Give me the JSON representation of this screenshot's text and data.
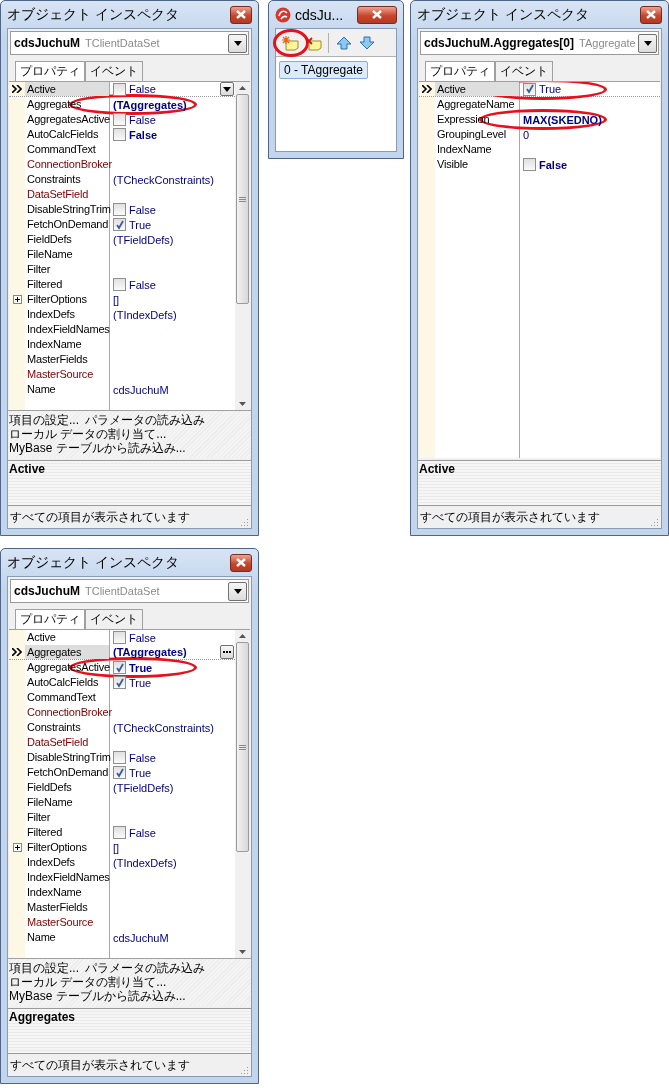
{
  "windows": [
    {
      "kind": "inspector",
      "title": "オブジェクト インスペクタ",
      "object_name": "cdsJuchuM",
      "object_type": "TClientDataSet",
      "tabs": [
        {
          "label": "プロパティ",
          "selected": true
        },
        {
          "label": "イベント",
          "selected": false
        }
      ],
      "properties": [
        {
          "name": "Active",
          "kind": "checkbox",
          "value": "False",
          "checked": false,
          "modified": false,
          "selected": true,
          "linked": false,
          "expandable": false,
          "highlighted": false,
          "editor": {
            "kind": "dropdown"
          }
        },
        {
          "name": "Aggregates",
          "kind": "text",
          "value": "(TAggregates)",
          "modified": true,
          "selected": false,
          "linked": false,
          "expandable": false,
          "highlighted": true
        },
        {
          "name": "AggregatesActive",
          "kind": "checkbox",
          "value": "False",
          "checked": false,
          "modified": false,
          "selected": false,
          "linked": false,
          "expandable": false,
          "highlighted": false
        },
        {
          "name": "AutoCalcFields",
          "kind": "checkbox",
          "value": "False",
          "checked": false,
          "modified": true,
          "selected": false,
          "linked": false,
          "expandable": false,
          "highlighted": false
        },
        {
          "name": "CommandText",
          "kind": "text",
          "selected": false,
          "linked": false,
          "expandable": false,
          "highlighted": false
        },
        {
          "name": "ConnectionBroker",
          "kind": "text",
          "selected": false,
          "linked": true,
          "expandable": false,
          "highlighted": false
        },
        {
          "name": "Constraints",
          "kind": "text",
          "value": "(TCheckConstraints)",
          "modified": false,
          "selected": false,
          "linked": false,
          "expandable": false,
          "highlighted": false
        },
        {
          "name": "DataSetField",
          "kind": "text",
          "selected": false,
          "linked": true,
          "expandable": false,
          "highlighted": false
        },
        {
          "name": "DisableStringTrim",
          "kind": "checkbox",
          "value": "False",
          "checked": false,
          "modified": false,
          "selected": false,
          "linked": false,
          "expandable": false,
          "highlighted": false
        },
        {
          "name": "FetchOnDemand",
          "kind": "checkbox",
          "value": "True",
          "checked": true,
          "modified": false,
          "selected": false,
          "linked": false,
          "expandable": false,
          "highlighted": false
        },
        {
          "name": "FieldDefs",
          "kind": "text",
          "value": "(TFieldDefs)",
          "modified": false,
          "selected": false,
          "linked": false,
          "expandable": false,
          "highlighted": false
        },
        {
          "name": "FileName",
          "kind": "text",
          "selected": false,
          "linked": false,
          "expandable": false,
          "highlighted": false
        },
        {
          "name": "Filter",
          "kind": "text",
          "selected": false,
          "linked": false,
          "expandable": false,
          "highlighted": false
        },
        {
          "name": "Filtered",
          "kind": "checkbox",
          "value": "False",
          "checked": false,
          "modified": false,
          "selected": false,
          "linked": false,
          "expandable": false,
          "highlighted": false
        },
        {
          "name": "FilterOptions",
          "kind": "text",
          "value": "[]",
          "modified": false,
          "selected": false,
          "linked": false,
          "expandable": true,
          "highlighted": false
        },
        {
          "name": "IndexDefs",
          "kind": "text",
          "value": "(TIndexDefs)",
          "modified": false,
          "selected": false,
          "linked": false,
          "expandable": false,
          "highlighted": false
        },
        {
          "name": "IndexFieldNames",
          "kind": "text",
          "selected": false,
          "linked": false,
          "expandable": false,
          "highlighted": false
        },
        {
          "name": "IndexName",
          "kind": "text",
          "selected": false,
          "linked": false,
          "expandable": false,
          "highlighted": false
        },
        {
          "name": "MasterFields",
          "kind": "text",
          "selected": false,
          "linked": false,
          "expandable": false,
          "highlighted": false
        },
        {
          "name": "MasterSource",
          "kind": "text",
          "selected": false,
          "linked": true,
          "expandable": false,
          "highlighted": false
        },
        {
          "name": "Name",
          "kind": "text",
          "value": "cdsJuchuM",
          "modified": false,
          "selected": false,
          "linked": false,
          "expandable": false,
          "highlighted": false
        }
      ],
      "verb_lines": [
        {
          "verbs": [
            "項目の設定...",
            "パラメータの読み込み"
          ]
        },
        {
          "verbs": [
            "ローカル データの割り当て..."
          ]
        },
        {
          "verbs": [
            "MyBase テーブルから読み込み..."
          ]
        }
      ],
      "help": "Active",
      "status": "すべての項目が表示されています"
    },
    {
      "kind": "collection",
      "title": "cdsJu...",
      "toolbar": [
        {
          "kind": "add",
          "highlighted": true
        },
        {
          "kind": "delete",
          "highlighted": false
        },
        {
          "kind": "up",
          "highlighted": false
        },
        {
          "kind": "down",
          "highlighted": false
        }
      ],
      "items": [
        {
          "label": "0 - TAggregate",
          "selected": true
        }
      ]
    },
    {
      "kind": "inspector",
      "title": "オブジェクト インスペクタ",
      "object_name": "cdsJuchuM.Aggregates[0]",
      "object_type": "TAggregate",
      "tabs": [
        {
          "label": "プロパティ",
          "selected": true
        },
        {
          "label": "イベント",
          "selected": false
        }
      ],
      "properties": [
        {
          "name": "Active",
          "kind": "checkbox",
          "value": "True",
          "checked": true,
          "modified": false,
          "selected": true,
          "linked": false,
          "expandable": false,
          "highlighted": true
        },
        {
          "name": "AggregateName",
          "kind": "text",
          "selected": false,
          "linked": false,
          "expandable": false,
          "highlighted": false
        },
        {
          "name": "Expression",
          "kind": "text",
          "value": "MAX(SKEDNO)",
          "modified": true,
          "selected": false,
          "linked": false,
          "expandable": false,
          "highlighted": true
        },
        {
          "name": "GroupingLevel",
          "kind": "text",
          "value": "0",
          "modified": false,
          "selected": false,
          "linked": false,
          "expandable": false,
          "highlighted": false
        },
        {
          "name": "IndexName",
          "kind": "text",
          "selected": false,
          "linked": false,
          "expandable": false,
          "highlighted": false
        },
        {
          "name": "Visible",
          "kind": "checkbox",
          "value": "False",
          "checked": false,
          "modified": true,
          "selected": false,
          "linked": false,
          "expandable": false,
          "highlighted": false
        }
      ],
      "help": "Active",
      "status": "すべての項目が表示されています"
    },
    {
      "kind": "inspector",
      "title": "オブジェクト インスペクタ",
      "object_name": "cdsJuchuM",
      "object_type": "TClientDataSet",
      "tabs": [
        {
          "label": "プロパティ",
          "selected": true
        },
        {
          "label": "イベント",
          "selected": false
        }
      ],
      "properties": [
        {
          "name": "Active",
          "kind": "checkbox",
          "value": "False",
          "checked": false,
          "modified": false,
          "selected": false,
          "linked": false,
          "expandable": false,
          "highlighted": false
        },
        {
          "name": "Aggregates",
          "kind": "text",
          "value": "(TAggregates)",
          "modified": true,
          "selected": true,
          "linked": false,
          "expandable": false,
          "highlighted": false,
          "editor": {
            "kind": "ellipsis"
          }
        },
        {
          "name": "AggregatesActive",
          "kind": "checkbox",
          "value": "True",
          "checked": true,
          "modified": true,
          "selected": false,
          "linked": false,
          "expandable": false,
          "highlighted": true
        },
        {
          "name": "AutoCalcFields",
          "kind": "checkbox",
          "value": "True",
          "checked": true,
          "modified": false,
          "selected": false,
          "linked": false,
          "expandable": false,
          "highlighted": false
        },
        {
          "name": "CommandText",
          "kind": "text",
          "selected": false,
          "linked": false,
          "expandable": false,
          "highlighted": false
        },
        {
          "name": "ConnectionBroker",
          "kind": "text",
          "selected": false,
          "linked": true,
          "expandable": false,
          "highlighted": false
        },
        {
          "name": "Constraints",
          "kind": "text",
          "value": "(TCheckConstraints)",
          "modified": false,
          "selected": false,
          "linked": false,
          "expandable": false,
          "highlighted": false
        },
        {
          "name": "DataSetField",
          "kind": "text",
          "selected": false,
          "linked": true,
          "expandable": false,
          "highlighted": false
        },
        {
          "name": "DisableStringTrim",
          "kind": "checkbox",
          "value": "False",
          "checked": false,
          "modified": false,
          "selected": false,
          "linked": false,
          "expandable": false,
          "highlighted": false
        },
        {
          "name": "FetchOnDemand",
          "kind": "checkbox",
          "value": "True",
          "checked": true,
          "modified": false,
          "selected": false,
          "linked": false,
          "expandable": false,
          "highlighted": false
        },
        {
          "name": "FieldDefs",
          "kind": "text",
          "value": "(TFieldDefs)",
          "modified": false,
          "selected": false,
          "linked": false,
          "expandable": false,
          "highlighted": false
        },
        {
          "name": "FileName",
          "kind": "text",
          "selected": false,
          "linked": false,
          "expandable": false,
          "highlighted": false
        },
        {
          "name": "Filter",
          "kind": "text",
          "selected": false,
          "linked": false,
          "expandable": false,
          "highlighted": false
        },
        {
          "name": "Filtered",
          "kind": "checkbox",
          "value": "False",
          "checked": false,
          "modified": false,
          "selected": false,
          "linked": false,
          "expandable": false,
          "highlighted": false
        },
        {
          "name": "FilterOptions",
          "kind": "text",
          "value": "[]",
          "modified": false,
          "selected": false,
          "linked": false,
          "expandable": true,
          "highlighted": false
        },
        {
          "name": "IndexDefs",
          "kind": "text",
          "value": "(TIndexDefs)",
          "modified": false,
          "selected": false,
          "linked": false,
          "expandable": false,
          "highlighted": false
        },
        {
          "name": "IndexFieldNames",
          "kind": "text",
          "selected": false,
          "linked": false,
          "expandable": false,
          "highlighted": false
        },
        {
          "name": "IndexName",
          "kind": "text",
          "selected": false,
          "linked": false,
          "expandable": false,
          "highlighted": false
        },
        {
          "name": "MasterFields",
          "kind": "text",
          "selected": false,
          "linked": false,
          "expandable": false,
          "highlighted": false
        },
        {
          "name": "MasterSource",
          "kind": "text",
          "selected": false,
          "linked": true,
          "expandable": false,
          "highlighted": false
        },
        {
          "name": "Name",
          "kind": "text",
          "value": "cdsJuchuM",
          "modified": false,
          "selected": false,
          "linked": false,
          "expandable": false,
          "highlighted": false
        }
      ],
      "verb_lines": [
        {
          "verbs": [
            "項目の設定...",
            "パラメータの読み込み"
          ]
        },
        {
          "verbs": [
            "ローカル データの割り当て..."
          ]
        },
        {
          "verbs": [
            "MyBase テーブルから読み込み..."
          ]
        }
      ],
      "help": "Aggregates",
      "status": "すべての項目が表示されています"
    }
  ]
}
